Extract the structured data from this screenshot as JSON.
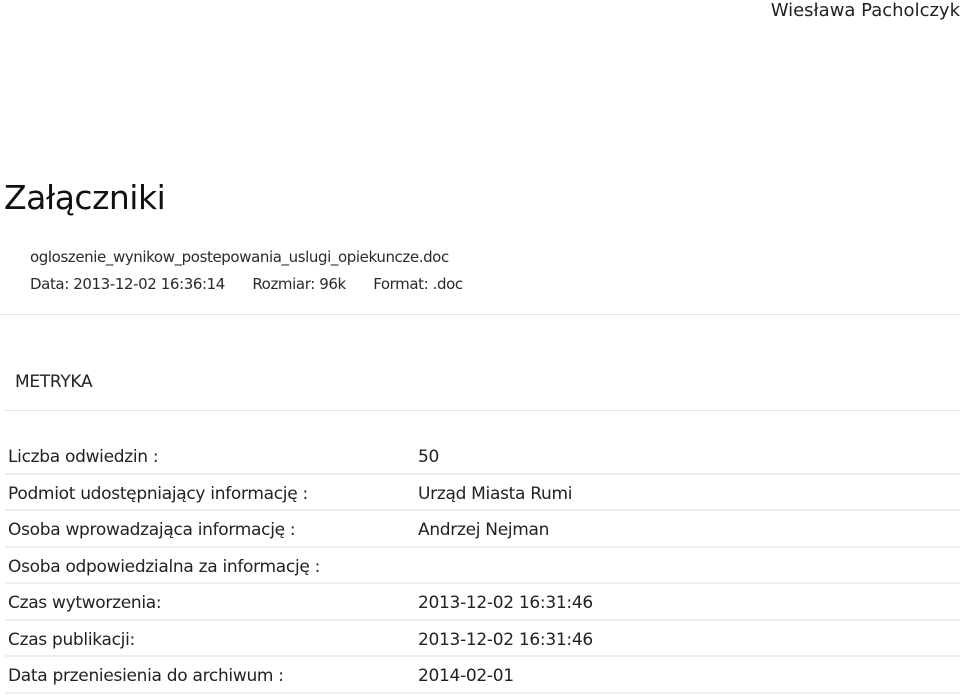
{
  "header": {
    "author": "Wiesława Pacholczyk"
  },
  "attachments": {
    "title": "Załączniki",
    "items": [
      {
        "filename": "ogloszenie_wynikow_postepowania_uslugi_opiekuncze.doc",
        "date": "Data: 2013-12-02 16:36:14",
        "size": "Rozmiar: 96k",
        "format": "Format: .doc"
      }
    ]
  },
  "metryka": {
    "title": "METRYKA",
    "rows": [
      {
        "label": "Liczba odwiedzin :",
        "value": "50"
      },
      {
        "label": "Podmiot udostępniający informację :",
        "value": "Urząd Miasta Rumi"
      },
      {
        "label": "Osoba wprowadzająca informację :",
        "value": "Andrzej Nejman"
      },
      {
        "label": "Osoba odpowiedzialna za informację :",
        "value": ""
      },
      {
        "label": "Czas wytworzenia:",
        "value": "2013-12-02 16:31:46"
      },
      {
        "label": "Czas publikacji:",
        "value": "2013-12-02 16:31:46"
      },
      {
        "label": "Data przeniesienia do archiwum :",
        "value": "2014-02-01"
      }
    ]
  }
}
